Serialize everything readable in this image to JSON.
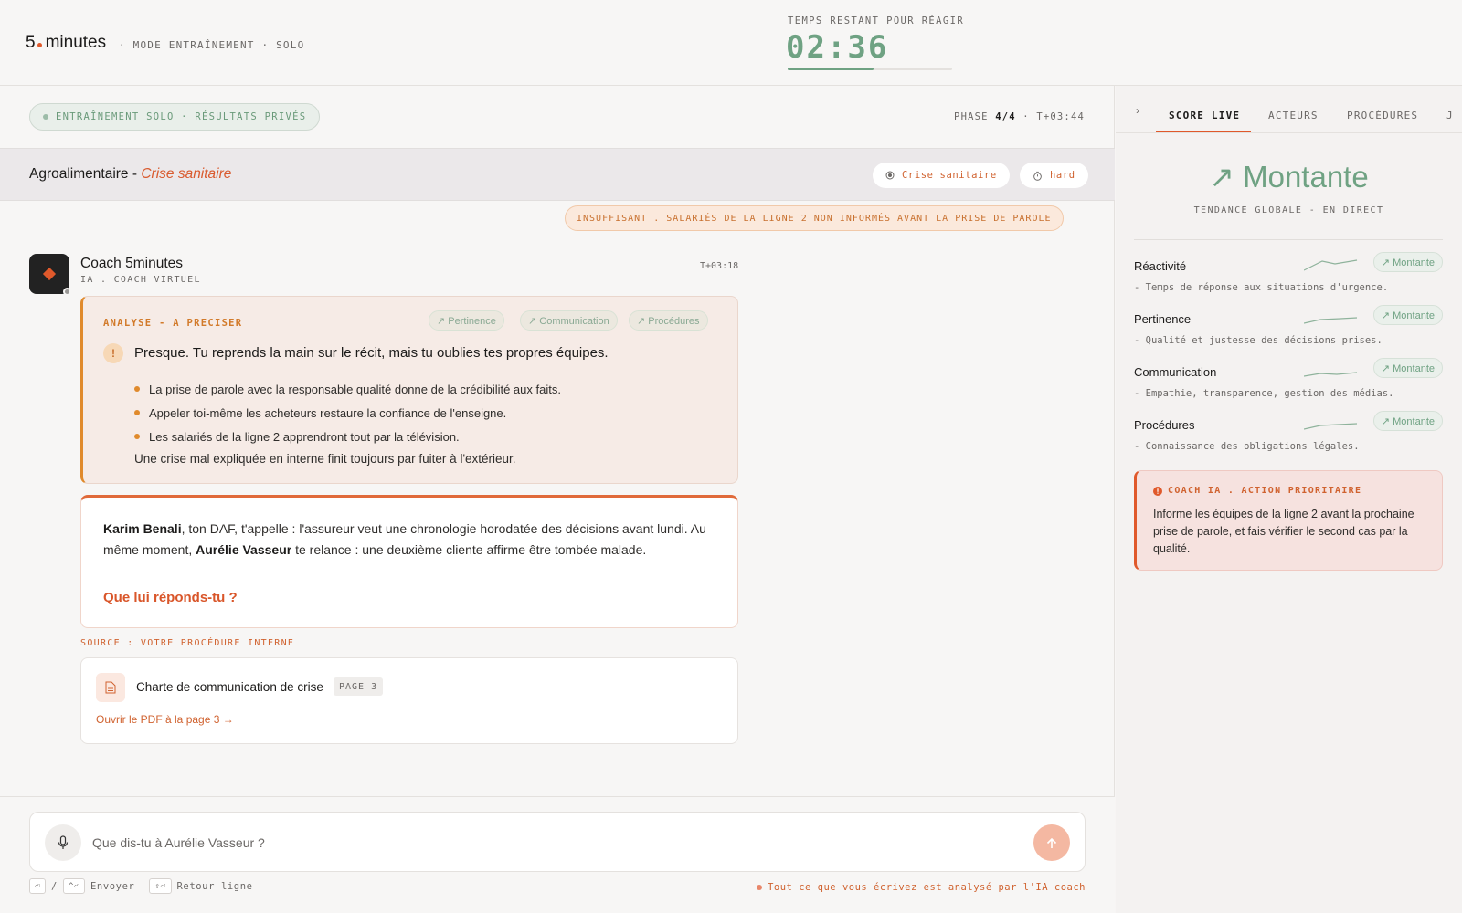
{
  "header": {
    "logo_number": "5",
    "logo_word": "minutes",
    "mode": "· MODE ENTRAÎNEMENT · SOLO",
    "timer_label": "TEMPS RESTANT POUR RÉAGIR",
    "timer": "02:36",
    "timer_progress": 0.52,
    "accent": "#6fa283"
  },
  "session": {
    "solo_badge": "ENTRAÎNEMENT SOLO · RÉSULTATS PRIVÉS",
    "phase_label": "PHASE",
    "phase_value": "4/4",
    "phase_time": "· T+03:44"
  },
  "scenario": {
    "sector": "Agroalimentaire -",
    "crisis": "Crise sanitaire",
    "chip_type": "Crise sanitaire",
    "chip_level": "hard"
  },
  "alert": "INSUFFISANT . SALARIÉS DE LA LIGNE 2 NON INFORMÉS AVANT LA PRISE DE PAROLE",
  "coach": {
    "name": "Coach 5minutes",
    "sub": "IA . COACH VIRTUEL",
    "time": "T+03:18"
  },
  "analysis": {
    "label": "ANALYSE - A PRECISER",
    "tags": [
      "↗ Pertinence",
      "↗ Communication",
      "↗ Procédures"
    ],
    "headline": "Presque. Tu reprends la main sur le récit, mais tu oublies tes propres équipes.",
    "points": [
      "La prise de parole avec la responsable qualité donne de la crédibilité aux faits.",
      "Appeler toi-même les acheteurs restaure la confiance de l'enseigne.",
      "Les salariés de la ligne 2 apprendront tout par la télévision."
    ],
    "conclusion": "Une crise mal expliquée en interne finit toujours par fuiter à l'extérieur.",
    "warn_icon": "!"
  },
  "question": {
    "person1": "Karim Benali",
    "text1": ", ton DAF, t'appelle : l'assureur veut une chronologie horodatée des décisions avant lundi. Au même moment, ",
    "person2": "Aurélie Vasseur",
    "text2": " te relance : une deuxième cliente affirme être tombée malade.",
    "ask": "Que lui réponds-tu ?"
  },
  "source": {
    "label": "SOURCE : VOTRE PROCÉDURE INTERNE",
    "title": "Charte de communication de crise",
    "page": "PAGE 3",
    "link": "Ouvrir le PDF à la page 3 →"
  },
  "composer": {
    "placeholder": "Que dis-tu à Aurélie Vasseur ?",
    "key_enter": "⏎",
    "slash": "/",
    "key_ctrl_enter": "^⏎",
    "send_label": "Envoyer",
    "key_shift_enter": "⇧⏎",
    "newline_label": "Retour ligne",
    "note": "Tout ce que vous écrivez est analysé par l'IA coach"
  },
  "panel": {
    "collapse": "›",
    "tabs": [
      "SCORE LIVE",
      "ACTEURS",
      "PROCÉDURES",
      "J"
    ],
    "trend": "↗ Montante",
    "trend_sub": "TENDANCE GLOBALE - EN DIRECT",
    "metrics": [
      {
        "name": "Réactivité",
        "desc": "- Temps de réponse aux situations d'urgence.",
        "badge": "↗ Montante"
      },
      {
        "name": "Pertinence",
        "desc": "- Qualité et justesse des décisions prises.",
        "badge": "↗ Montante"
      },
      {
        "name": "Communication",
        "desc": "- Empathie, transparence, gestion des médias.",
        "badge": "↗ Montante"
      },
      {
        "name": "Procédures",
        "desc": "- Connaissance des obligations légales.",
        "badge": "↗ Montante"
      }
    ],
    "priority_label": "COACH IA . ACTION PRIORITAIRE",
    "priority_text": "Informe les équipes de la ligne 2 avant la prochaine prise de parole, et fais vérifier le second cas par la qualité."
  },
  "colors": {
    "brand_orange": "#e0592b",
    "positive_green": "#6fa283",
    "warning_amber": "#e08a2c"
  }
}
